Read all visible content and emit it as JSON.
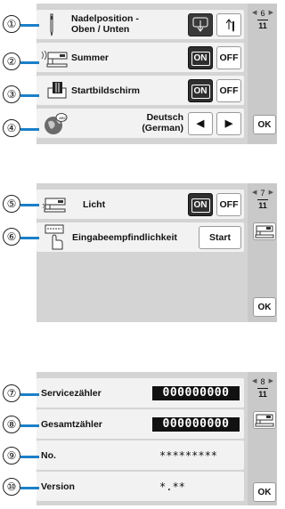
{
  "callouts": [
    "①",
    "②",
    "③",
    "④",
    "⑤",
    "⑥",
    "⑦",
    "⑧",
    "⑨",
    "⑩"
  ],
  "screen1": {
    "rows": [
      {
        "label": "Nadelposition -\nOben / Unten",
        "icon": "needle-icon",
        "buttons": [
          "needle-down-icon",
          "needle-up-icon"
        ]
      },
      {
        "label": "Summer",
        "icon": "buzzer-machine-icon",
        "on": "ON",
        "off": "OFF"
      },
      {
        "label": "Startbildschirm",
        "icon": "start-screen-icon",
        "on": "ON",
        "off": "OFF"
      },
      {
        "label": "Deutsch\n(German)",
        "icon": "globe-icon",
        "prev": "◀",
        "next": "▶"
      }
    ],
    "page_current": "6",
    "page_total": "11",
    "ok": "OK"
  },
  "screen2": {
    "rows": [
      {
        "label": "Licht",
        "icon": "light-machine-icon",
        "on": "ON",
        "off": "OFF"
      },
      {
        "label": "Eingabeempfindlichkeit",
        "icon": "touch-sensitivity-icon",
        "button": "Start"
      }
    ],
    "page_current": "7",
    "page_total": "11",
    "ok": "OK"
  },
  "screen3": {
    "rows": [
      {
        "label": "Servicezähler",
        "value": "000000000"
      },
      {
        "label": "Gesamtzähler",
        "value": "000000000"
      },
      {
        "label": "No.",
        "value": "*********"
      },
      {
        "label": "Version",
        "value": "*.**"
      }
    ],
    "page_current": "8",
    "page_total": "11",
    "ok": "OK"
  },
  "colors": {
    "leader": "#1b7fc8",
    "panel": "#d4d4d4",
    "row": "#f2f2f2",
    "dark_button": "#2f2f2f"
  }
}
